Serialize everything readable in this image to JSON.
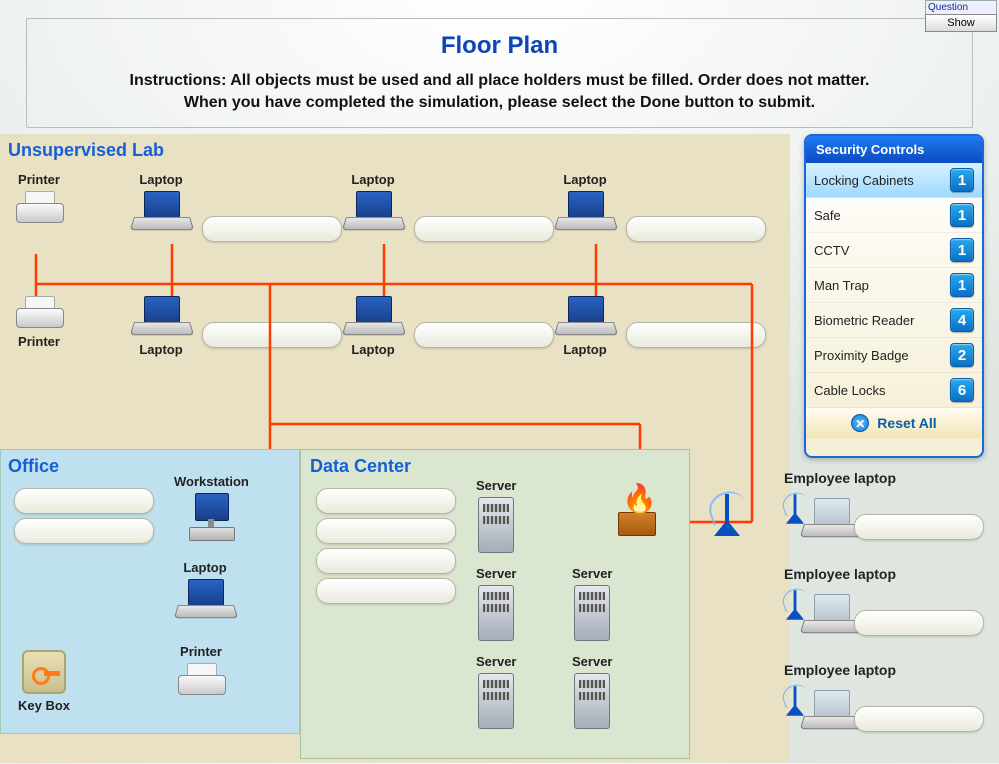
{
  "question_label": "Question",
  "show_button": "Show",
  "title": "Floor Plan",
  "instructions_l1": "Instructions: All objects must be used and all place holders must be filled. Order does not matter.",
  "instructions_l2": "When you have completed the simulation, please select the Done button to submit.",
  "zones": {
    "lab": "Unsupervised Lab",
    "office": "Office",
    "dc": "Data Center"
  },
  "labels": {
    "printer": "Printer",
    "laptop": "Laptop",
    "workstation": "Workstation",
    "server": "Server",
    "keybox": "Key Box",
    "employee_laptop": "Employee laptop"
  },
  "panel": {
    "title": "Security Controls",
    "reset": "Reset  All",
    "items": [
      {
        "name": "Locking Cabinets",
        "count": 1,
        "selected": true
      },
      {
        "name": "Safe",
        "count": 1
      },
      {
        "name": "CCTV",
        "count": 1
      },
      {
        "name": "Man Trap",
        "count": 1
      },
      {
        "name": "Biometric Reader",
        "count": 4
      },
      {
        "name": "Proximity Badge",
        "count": 2
      },
      {
        "name": "Cable Locks",
        "count": 6
      }
    ]
  }
}
